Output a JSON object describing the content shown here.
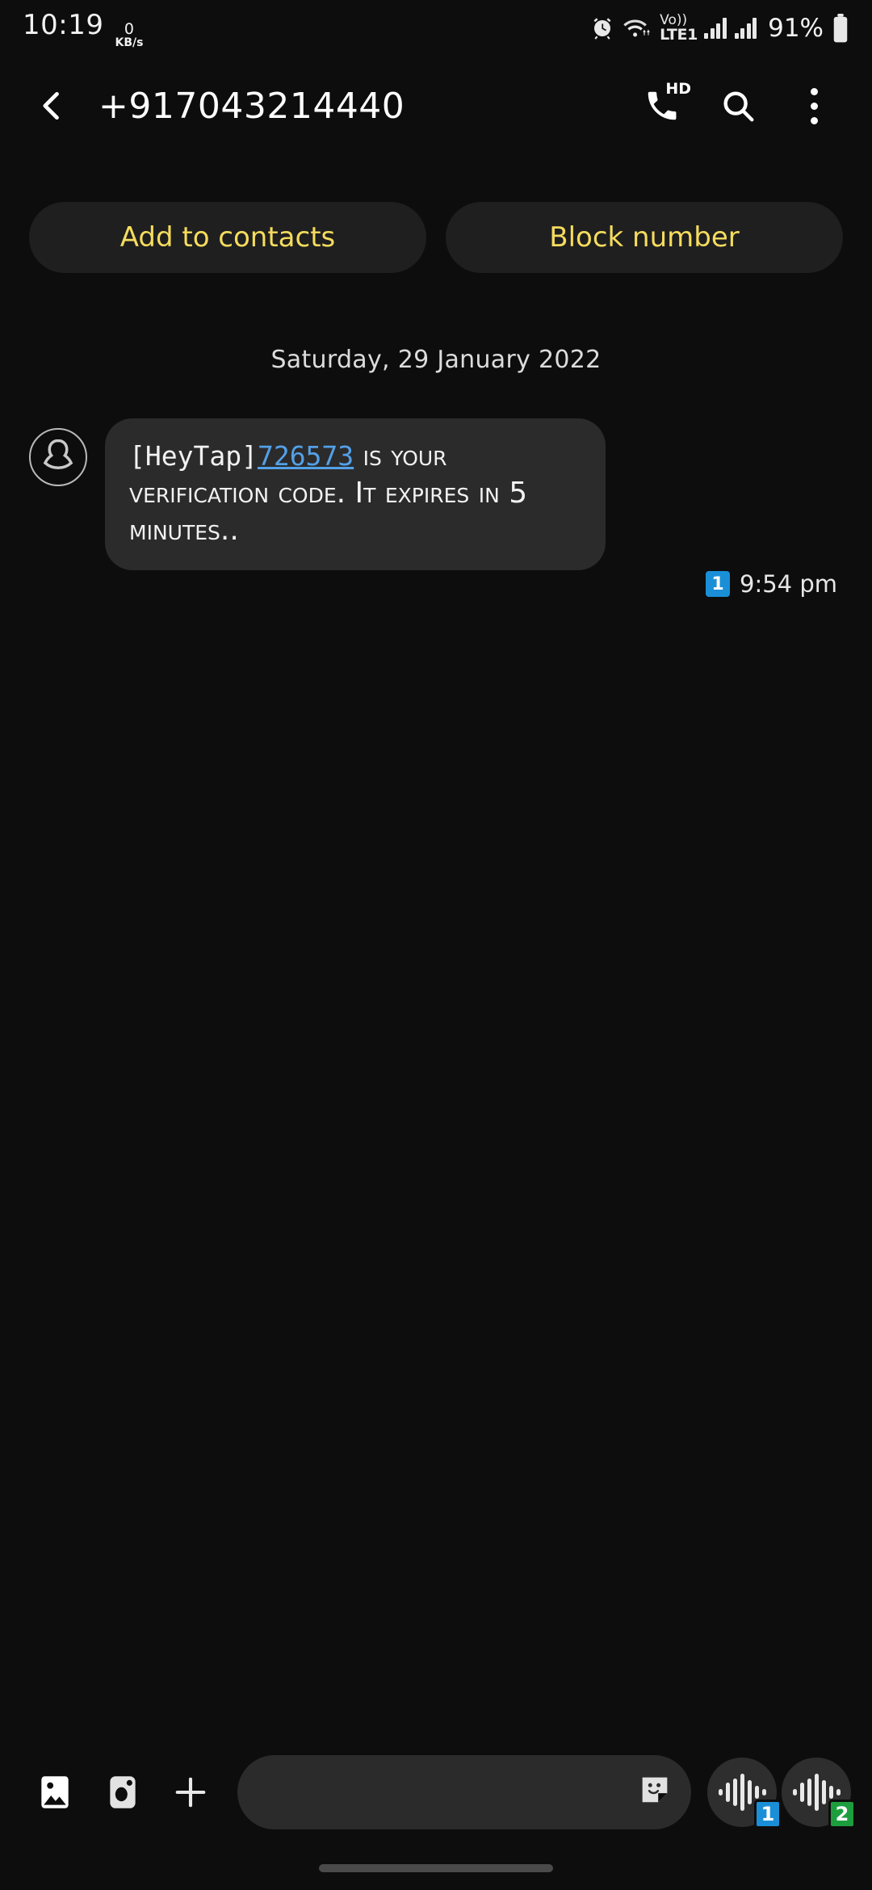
{
  "status_bar": {
    "clock": "10:19",
    "net_speed_value": "0",
    "net_speed_unit": "KB/s",
    "alarm_icon": "alarm-clock-icon",
    "wifi_icon": "wifi-icon",
    "volte_top": "Vo))",
    "volte_bottom": "LTE1",
    "signal_1_icon": "signal-bars-icon",
    "signal_2_icon": "signal-bars-icon",
    "battery_percent": "91%",
    "battery_icon": "battery-icon"
  },
  "header": {
    "back_icon": "chevron-left-icon",
    "title": "+917043214440",
    "call_icon": "phone-hd-icon",
    "call_hd_label": "HD",
    "search_icon": "search-icon",
    "more_icon": "kebab-menu-icon"
  },
  "actions": {
    "add_to_contacts": "Add to contacts",
    "block_number": "Block number",
    "accent_color": "#f5dc5e",
    "chip_bg": "#1f1f1f"
  },
  "conversation": {
    "date_separator": "Saturday, 29 January 2022",
    "messages": [
      {
        "avatar_icon": "person-avatar-icon",
        "text_prefix": "[HeyTap]",
        "code": "726573",
        "text_suffix": " is your verification code. It expires in 5 minutes..",
        "full_text": "[HeyTap]726573 is your verification code. It expires in 5 minutes..",
        "sim_badge": "1",
        "sim_badge_color": "#1a8fd8",
        "time": "9:54 pm",
        "link_color": "#53a0e8",
        "bubble_color": "#2b2b2b"
      }
    ]
  },
  "composer": {
    "gallery_icon": "image-icon",
    "camera_icon": "camera-icon",
    "add_icon": "plus-icon",
    "input_value": "",
    "input_placeholder": "",
    "sticker_icon": "sticker-smiley-icon",
    "send_buttons": [
      {
        "icon": "voice-waveform-icon",
        "sim": "1",
        "color": "#1a8fd8"
      },
      {
        "icon": "voice-waveform-icon",
        "sim": "2",
        "color": "#1d9e3e"
      }
    ]
  },
  "system_nav": {
    "handle": "gesture-handle"
  }
}
